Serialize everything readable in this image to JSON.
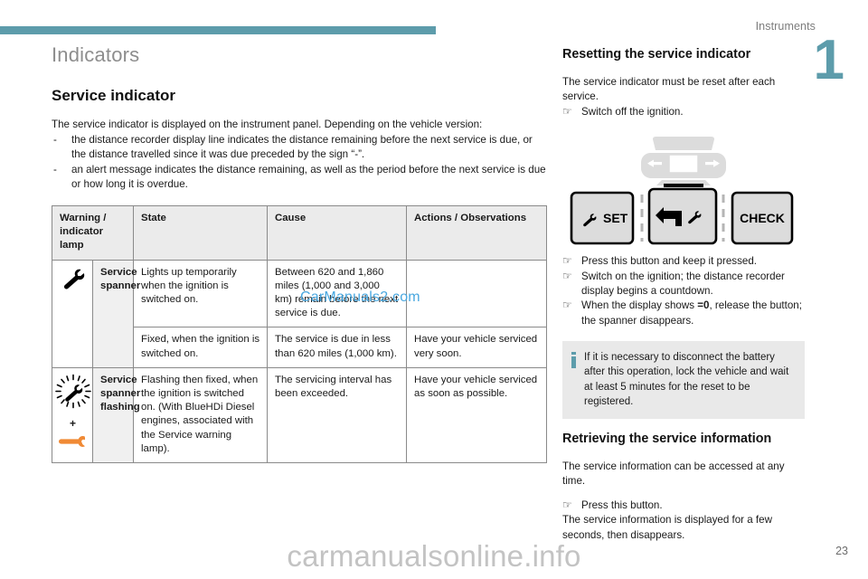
{
  "header": {
    "section_label": "Instruments",
    "chapter_number": "1"
  },
  "left": {
    "section_title": "Indicators",
    "sub_title": "Service indicator",
    "intro": "The service indicator is displayed on the instrument panel. Depending on the vehicle version:",
    "bullets": [
      "the distance recorder display line indicates the distance remaining before the next service is due, or the distance travelled since it was due preceded by the sign “-”.",
      "an alert message indicates the distance remaining, as well as the period before the next service is due or how long it is overdue."
    ],
    "dash": "-"
  },
  "table": {
    "headers": {
      "lamp": "Warning / indicator lamp",
      "state": "State",
      "cause": "Cause",
      "actions": "Actions / Observations"
    },
    "rows": [
      {
        "lamp_icon": "spanner-icon",
        "name": "Service spanner",
        "sub_rows": [
          {
            "state": "Lights up temporarily when the ignition is switched on.",
            "cause": "Between 620 and 1,860 miles (1,000 and 3,000 km) remain before the next service is due.",
            "actions": ""
          },
          {
            "state": "Fixed, when the ignition is switched on.",
            "cause": "The service is due in less than 620 miles (1,000 km).",
            "actions": "Have your vehicle serviced very soon."
          }
        ]
      },
      {
        "lamp_icon": "spanner-flashing-icon",
        "plus": "+",
        "lamp_icon2": "orange-spanner-icon",
        "name": "Service spanner flashing",
        "sub_rows": [
          {
            "state": "Flashing then fixed, when the ignition is switched on. (With BlueHDi Diesel engines, associated with the Service warning lamp).",
            "cause": "The servicing interval has been exceeded.",
            "actions": "Have your vehicle serviced as soon as possible."
          }
        ]
      }
    ]
  },
  "right": {
    "reset_heading": "Resetting the service indicator",
    "reset_intro": "The service indicator must be reset after each service.",
    "reset_first_step": "Switch off the ignition.",
    "buttons": {
      "set_label": "SET",
      "check_label": "CHECK"
    },
    "reset_steps": [
      "Press this button and keep it pressed.",
      "Switch on the ignition; the distance recorder display begins a countdown.",
      "When the display shows =0, release the button; the spanner disappears."
    ],
    "reset_step3_pre": "When the display shows ",
    "reset_step3_bold": "=0",
    "reset_step3_post": ", release the button; the spanner disappears.",
    "note": "If it is necessary to disconnect the battery after this operation, lock the vehicle and wait at least 5 minutes for the reset to be registered.",
    "retrieve_heading": "Retrieving the service information",
    "retrieve_intro": "The service information can be accessed at any time.",
    "retrieve_step": "Press this button.",
    "retrieve_outro": "The service information is displayed for a few seconds, then disappears."
  },
  "watermarks": {
    "table": "CarManuals2.com",
    "footer": "carmanualsonline.info"
  },
  "footer": {
    "page_number": "23"
  },
  "colors": {
    "accent": "#5d9cab",
    "orange": "#f08a35",
    "watermark_blue": "#4aa8e0",
    "note_bg": "#e9e9e9"
  },
  "icons": {
    "hand_pointer": "☞"
  }
}
